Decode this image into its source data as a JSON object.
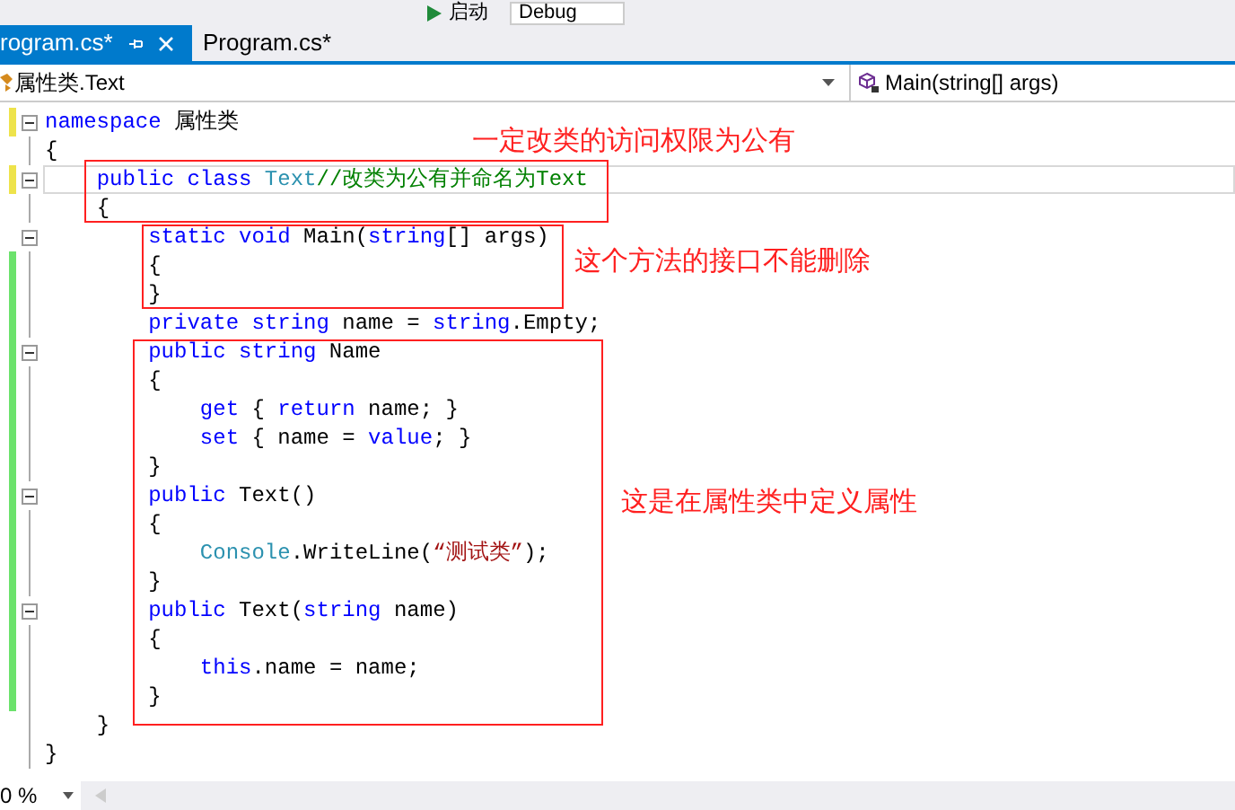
{
  "toolbar": {
    "start_button": "启动",
    "configuration": "Debug"
  },
  "tabs": [
    {
      "label": "rogram.cs*",
      "selected": true,
      "pinned": true
    },
    {
      "label": "Program.cs*",
      "selected": false,
      "pinned": false
    }
  ],
  "navigation": {
    "type_scope": "属性类.Text",
    "member_scope": "Main(string[] args)"
  },
  "code": {
    "lines": [
      {
        "color": "#eee34b",
        "collapsible": true,
        "current": false,
        "segments": [
          {
            "kind": "keyword",
            "text": "namespace"
          },
          {
            "kind": "plain",
            "text": " 属性类"
          }
        ]
      },
      {
        "collapsible": false,
        "current": false,
        "segments": [
          {
            "kind": "plain",
            "text": "{"
          }
        ]
      },
      {
        "color": "#eee34b",
        "collapsible": true,
        "current": true,
        "segments": [
          {
            "kind": "keyword",
            "text": "    public class"
          },
          {
            "kind": "type",
            "text": " Text"
          },
          {
            "kind": "comment",
            "text": "//改类为公有并命名为Text"
          }
        ]
      },
      {
        "collapsible": false,
        "current": false,
        "segments": [
          {
            "kind": "plain",
            "text": "    {"
          }
        ]
      },
      {
        "collapsible": true,
        "current": false,
        "segments": [
          {
            "kind": "keyword",
            "text": "        static void"
          },
          {
            "kind": "plain",
            "text": " Main("
          },
          {
            "kind": "keyword",
            "text": "string"
          },
          {
            "kind": "plain",
            "text": "[] args)"
          }
        ]
      },
      {
        "color": "#6ce26c",
        "collapsible": false,
        "current": false,
        "segments": [
          {
            "kind": "plain",
            "text": "        {"
          }
        ]
      },
      {
        "color": "#6ce26c",
        "collapsible": false,
        "current": false,
        "segments": [
          {
            "kind": "plain",
            "text": "        }"
          }
        ]
      },
      {
        "color": "#6ce26c",
        "collapsible": false,
        "current": false,
        "segments": [
          {
            "kind": "keyword",
            "text": "        private string"
          },
          {
            "kind": "plain",
            "text": " name = "
          },
          {
            "kind": "keyword",
            "text": "string"
          },
          {
            "kind": "plain",
            "text": ".Empty;"
          }
        ]
      },
      {
        "color": "#6ce26c",
        "collapsible": true,
        "current": false,
        "segments": [
          {
            "kind": "keyword",
            "text": "        public string"
          },
          {
            "kind": "plain",
            "text": " Name"
          }
        ]
      },
      {
        "color": "#6ce26c",
        "collapsible": false,
        "current": false,
        "segments": [
          {
            "kind": "plain",
            "text": "        {"
          }
        ]
      },
      {
        "color": "#6ce26c",
        "collapsible": false,
        "current": false,
        "segments": [
          {
            "kind": "keyword",
            "text": "            get"
          },
          {
            "kind": "plain",
            "text": " { "
          },
          {
            "kind": "keyword",
            "text": "return"
          },
          {
            "kind": "plain",
            "text": " name; }"
          }
        ]
      },
      {
        "color": "#6ce26c",
        "collapsible": false,
        "current": false,
        "segments": [
          {
            "kind": "keyword",
            "text": "            set"
          },
          {
            "kind": "plain",
            "text": " { name = "
          },
          {
            "kind": "keyword",
            "text": "value"
          },
          {
            "kind": "plain",
            "text": "; }"
          }
        ]
      },
      {
        "color": "#6ce26c",
        "collapsible": false,
        "current": false,
        "segments": [
          {
            "kind": "plain",
            "text": "        }"
          }
        ]
      },
      {
        "color": "#6ce26c",
        "collapsible": true,
        "current": false,
        "segments": [
          {
            "kind": "keyword",
            "text": "        public"
          },
          {
            "kind": "plain",
            "text": " Text()"
          }
        ]
      },
      {
        "color": "#6ce26c",
        "collapsible": false,
        "current": false,
        "segments": [
          {
            "kind": "plain",
            "text": "        {"
          }
        ]
      },
      {
        "color": "#6ce26c",
        "collapsible": false,
        "current": false,
        "segments": [
          {
            "kind": "type",
            "text": "            Console"
          },
          {
            "kind": "plain",
            "text": ".WriteLine("
          },
          {
            "kind": "string",
            "text": "“测试类”"
          },
          {
            "kind": "plain",
            "text": ");"
          }
        ]
      },
      {
        "color": "#6ce26c",
        "collapsible": false,
        "current": false,
        "segments": [
          {
            "kind": "plain",
            "text": "        }"
          }
        ]
      },
      {
        "color": "#6ce26c",
        "collapsible": true,
        "current": false,
        "segments": [
          {
            "kind": "keyword",
            "text": "        public"
          },
          {
            "kind": "plain",
            "text": " Text("
          },
          {
            "kind": "keyword",
            "text": "string"
          },
          {
            "kind": "plain",
            "text": " name)"
          }
        ]
      },
      {
        "color": "#6ce26c",
        "collapsible": false,
        "current": false,
        "segments": [
          {
            "kind": "plain",
            "text": "        {"
          }
        ]
      },
      {
        "color": "#6ce26c",
        "collapsible": false,
        "current": false,
        "segments": [
          {
            "kind": "keyword",
            "text": "            this"
          },
          {
            "kind": "plain",
            "text": ".name = name;"
          }
        ]
      },
      {
        "color": "#6ce26c",
        "collapsible": false,
        "current": false,
        "segments": [
          {
            "kind": "plain",
            "text": "        }"
          }
        ]
      },
      {
        "collapsible": false,
        "current": false,
        "segments": [
          {
            "kind": "plain",
            "text": "    }"
          }
        ]
      },
      {
        "collapsible": false,
        "current": false,
        "segments": [
          {
            "kind": "plain",
            "text": "}"
          }
        ]
      }
    ]
  },
  "annotations": [
    {
      "text": "一定改类的访问权限为公有"
    },
    {
      "text": "这个方法的接口不能删除"
    },
    {
      "text": "这是在属性类中定义属性"
    }
  ],
  "status_bar": {
    "zoom": "0 %"
  }
}
